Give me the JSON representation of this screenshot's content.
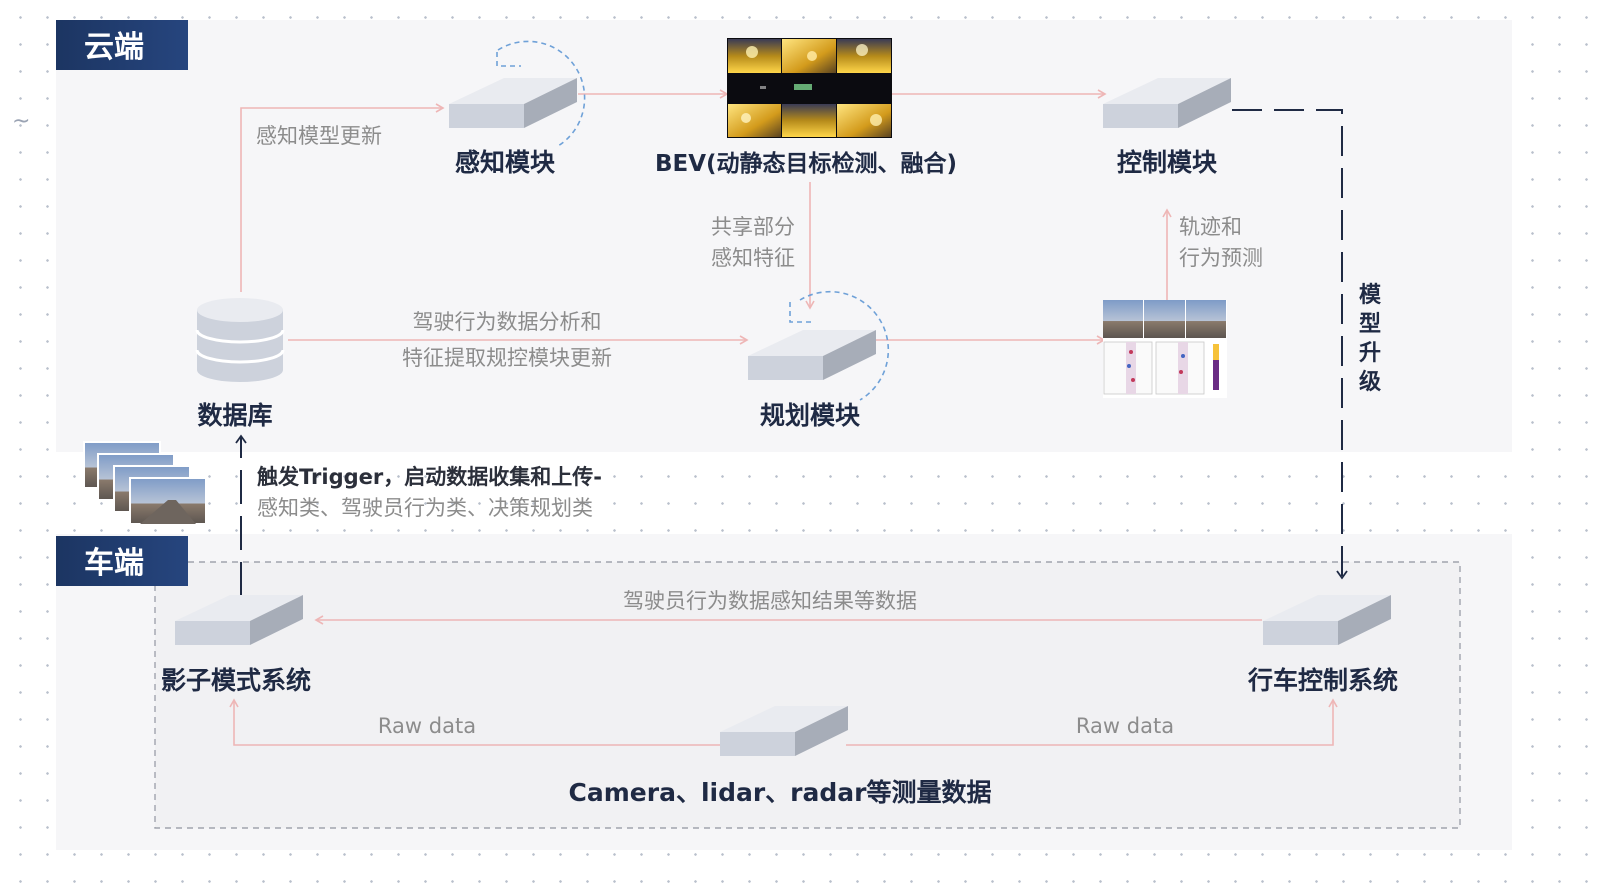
{
  "cloud": {
    "title": "云端",
    "perception_module": "感知模块",
    "bev": "BEV(动静态目标检测、融合)",
    "control_module": "控制模块",
    "planning_module": "规划模块",
    "database": "数据库",
    "model_update": "感知模型更新",
    "shared_features": [
      "共享部分",
      "感知特征"
    ],
    "trajectory_prediction": [
      "轨迹和",
      "行为预测"
    ],
    "behavior_analysis": [
      "驾驶行为数据分析和",
      "特征提取规控模块更新"
    ],
    "model_upgrade": [
      "模",
      "型",
      "升",
      "级"
    ]
  },
  "trigger": {
    "line1": "触发Trigger，启动数据收集和上传-",
    "line2": "感知类、驾驶员行为类、决策规划类"
  },
  "vehicle": {
    "title": "车端",
    "shadow_system": "影子模式系统",
    "driving_control_system": "行车控制系统",
    "driver_data": "驾驶员行为数据感知结果等数据",
    "raw_data_left": "Raw data",
    "raw_data_right": "Raw data",
    "sensors": "Camera、lidar、radar等测量数据"
  },
  "colors": {
    "title_block": "#1f3b73",
    "arrow": "#eeb6b6",
    "dashed_circle": "#6fa1d8",
    "box_top": "#e9ebf0",
    "box_front": "#cdd2dc",
    "box_side": "#a7adb8",
    "panel": "#f6f6f8"
  }
}
